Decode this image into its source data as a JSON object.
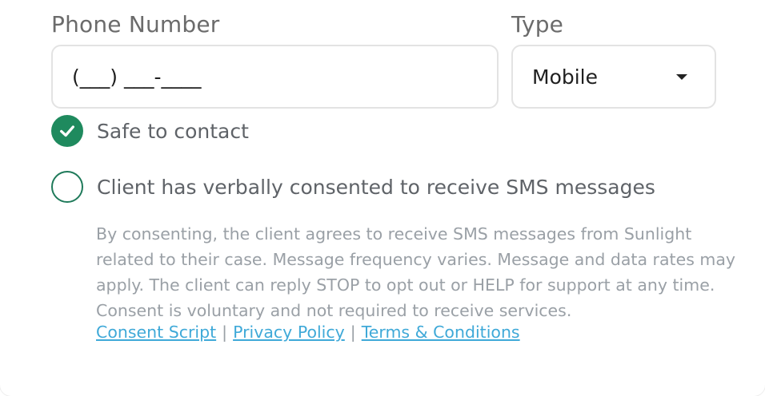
{
  "phone": {
    "label": "Phone Number",
    "value": "(___) ___-____"
  },
  "type": {
    "label": "Type",
    "selected": "Mobile"
  },
  "options": {
    "safe_to_contact": {
      "label": "Safe to contact",
      "checked": true
    },
    "sms_consent": {
      "label": "Client has verbally consented to receive SMS messages",
      "checked": false
    }
  },
  "consent": {
    "text": "By consenting, the client agrees to receive SMS messages from Sunlight related to their case. Message frequency varies. Message and data rates may apply. The client can reply STOP to opt out or HELP for support at any time. Consent is voluntary and not required to receive services.",
    "links": {
      "consent_script": "Consent Script",
      "privacy_policy": "Privacy Policy",
      "terms": "Terms & Conditions",
      "separator": "|"
    }
  },
  "colors": {
    "accent_green": "#1f8a5e",
    "link_blue": "#3fa9d8"
  }
}
